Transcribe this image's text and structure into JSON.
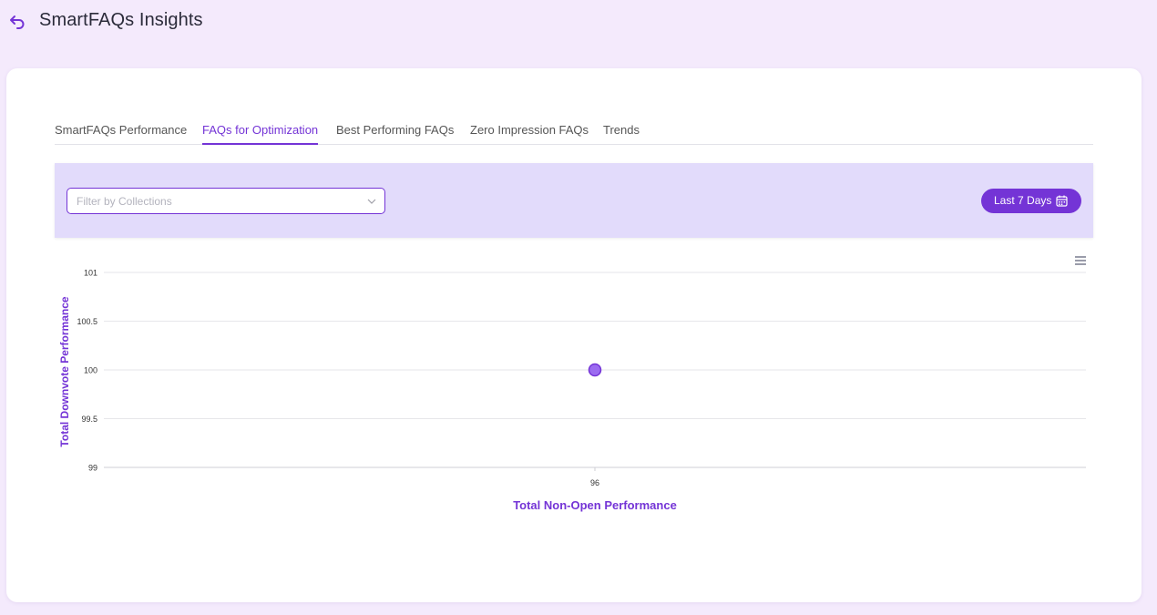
{
  "header": {
    "title": "SmartFAQs Insights"
  },
  "tabs": [
    {
      "label": "SmartFAQs Performance",
      "active": false
    },
    {
      "label": "FAQs for Optimization",
      "active": true
    },
    {
      "label": "Best Performing FAQs",
      "active": false
    },
    {
      "label": "Zero Impression FAQs",
      "active": false
    },
    {
      "label": "Trends",
      "active": false
    }
  ],
  "filter": {
    "placeholder": "Filter by Collections"
  },
  "date_button": {
    "label": "Last 7 Days"
  },
  "colors": {
    "accent": "#7434d6",
    "point": "#9b6bf0",
    "band": "#e2dbfb",
    "background": "#f4eafc"
  },
  "chart_data": {
    "type": "scatter",
    "xlabel": "Total Non-Open Performance",
    "ylabel": "Total Downvote Performance",
    "x_ticks": [
      "96"
    ],
    "y_ticks": [
      "101",
      "100.5",
      "100",
      "99.5",
      "99"
    ],
    "ylim": [
      99,
      101
    ],
    "grid": true,
    "series": [
      {
        "points": [
          {
            "x": 96,
            "y": 100
          }
        ]
      }
    ]
  }
}
